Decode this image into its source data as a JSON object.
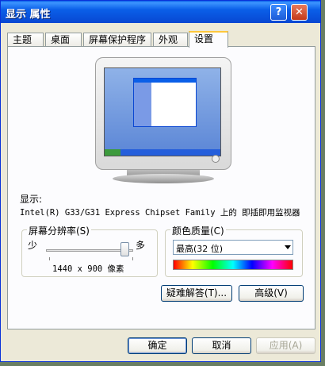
{
  "window": {
    "title": "显示 属性",
    "help_glyph": "?",
    "close_glyph": "✕"
  },
  "tabs": [
    "主题",
    "桌面",
    "屏幕保护程序",
    "外观",
    "设置"
  ],
  "settings": {
    "display_label": "显示:",
    "display_value": "Intel(R) G33/G31 Express Chipset Family 上的 即插即用监视器",
    "resolution": {
      "title": "屏幕分辨率(S)",
      "less": "少",
      "more": "多",
      "value": "1440 x 900 像素",
      "slider_level": 0.9
    },
    "color_quality": {
      "title": "颜色质量(C)",
      "value": "最高(32 位)"
    },
    "troubleshoot_label": "疑难解答(T)...",
    "advanced_label": "高级(V)"
  },
  "buttons": {
    "ok": "确定",
    "cancel": "取消",
    "apply": "应用(A)"
  }
}
